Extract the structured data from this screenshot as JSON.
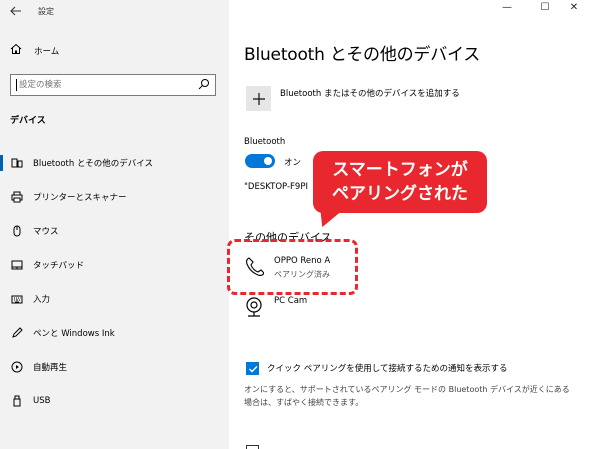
{
  "window": {
    "title": "設定",
    "minimize": "—",
    "maximize": "☐",
    "close": "✕"
  },
  "sidebar": {
    "home_label": "ホーム",
    "search_placeholder": "設定の検索",
    "section_title": "デバイス",
    "items": [
      {
        "label": "Bluetooth とその他のデバイス",
        "icon": "bluetooth-devices-icon",
        "active": true
      },
      {
        "label": "プリンターとスキャナー",
        "icon": "printer-icon",
        "active": false
      },
      {
        "label": "マウス",
        "icon": "mouse-icon",
        "active": false
      },
      {
        "label": "タッチパッド",
        "icon": "touchpad-icon",
        "active": false
      },
      {
        "label": "入力",
        "icon": "keyboard-icon",
        "active": false
      },
      {
        "label": "ペンと Windows Ink",
        "icon": "pen-icon",
        "active": false
      },
      {
        "label": "自動再生",
        "icon": "autoplay-icon",
        "active": false
      },
      {
        "label": "USB",
        "icon": "usb-icon",
        "active": false
      }
    ]
  },
  "main": {
    "title": "Bluetooth とその他のデバイス",
    "add_label": "Bluetooth またはその他のデバイスを追加する",
    "bluetooth_heading": "Bluetooth",
    "toggle_state": "オン",
    "discoverable_name": "\"DESKTOP-F9PI",
    "other_devices_heading": "その他のデバイス",
    "devices": [
      {
        "name": "OPPO Reno A",
        "status": "ペアリング済み",
        "icon": "phone-icon"
      },
      {
        "name": "PC Cam",
        "status": "",
        "icon": "webcam-icon"
      }
    ],
    "swift_pair_label": "クイック ペアリングを使用して接続するための通知を表示する",
    "swift_pair_checked": true,
    "swift_pair_desc": "オンにすると、サポートされているペアリング モードの Bluetooth デバイスが近くにある場合は、すばやく接続できます。"
  },
  "annotation": {
    "line1": "スマートフォンが",
    "line2": "ペアリングされた",
    "color": "#e8282e"
  },
  "colors": {
    "accent": "#0078d7",
    "sidebar_bg": "#f2f2f2"
  }
}
